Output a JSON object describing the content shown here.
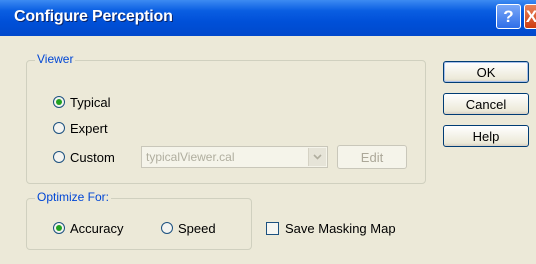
{
  "window": {
    "title": "Configure Perception"
  },
  "titlebar": {
    "help_glyph": "?",
    "close_glyph": "X"
  },
  "viewer": {
    "legend": "Viewer",
    "options": [
      {
        "label": "Typical",
        "selected": true
      },
      {
        "label": "Expert",
        "selected": false
      },
      {
        "label": "Custom",
        "selected": false
      }
    ],
    "custom_file": "typicalViewer.cal",
    "edit_label": "Edit"
  },
  "optimize": {
    "legend": "Optimize For:",
    "options": [
      {
        "label": "Accuracy",
        "selected": true
      },
      {
        "label": "Speed",
        "selected": false
      }
    ]
  },
  "masking": {
    "label": "Save Masking Map",
    "checked": false
  },
  "buttons": {
    "ok": "OK",
    "cancel": "Cancel",
    "help": "Help"
  },
  "icons": {
    "dropdown": "chevron-down-icon",
    "help": "help-icon",
    "close": "close-icon"
  },
  "colors": {
    "titlebar": "#0a5ee2",
    "accent_text": "#0046d5",
    "selected_radio": "#21a121"
  }
}
